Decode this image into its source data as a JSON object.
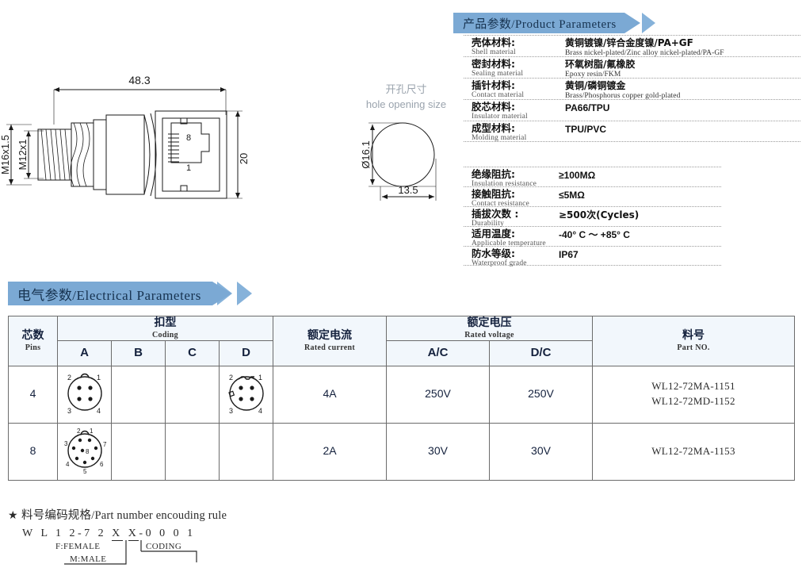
{
  "banners": {
    "product": {
      "zh": "产品参数",
      "sep": "/",
      "en": "Product Parameters"
    },
    "electrical": {
      "zh": "电气参数",
      "sep": "/",
      "en": "Electrical Parameters"
    }
  },
  "drawing": {
    "length_dim": "48.3",
    "height_dim": "20",
    "thread_outer": "M16x1.5",
    "thread_inner": "M12x1",
    "jack_pin_top": "8",
    "jack_pin_bottom": "1"
  },
  "hole_opening": {
    "title_zh": "开孔尺寸",
    "title_en": "hole opening size",
    "diameter": "Ø16.1",
    "width": "13.5"
  },
  "materials": [
    {
      "zh": "壳体材料:",
      "en": "Shell material",
      "value_zh": "黄铜镀镍/锌合金度镍/PA+GF",
      "value_en": "Brass nickel-plated/Zinc alloy nickel-plated/PA-GF"
    },
    {
      "zh": "密封材料:",
      "en": "Sealing material",
      "value_zh": "环氧树脂/氟橡胶",
      "value_en": "Epoxy resin/FKM"
    },
    {
      "zh": "插针材料:",
      "en": "Contact material",
      "value_zh": "黄铜/磷铜镀金",
      "value_en": "Brass/Phosphorus copper gold-plated"
    },
    {
      "zh": "胶芯材料:",
      "en": "Insulator material",
      "value_zh": "PA66/TPU",
      "value_en": ""
    },
    {
      "zh": "成型材料:",
      "en": "Molding material",
      "value_zh": "TPU/PVC",
      "value_en": ""
    }
  ],
  "electrical_spec": [
    {
      "zh": "绝缘阻抗:",
      "en": "Insulation resistance",
      "value": "≥100MΩ"
    },
    {
      "zh": "接触阻抗:",
      "en": "Contact resistance",
      "value": "≤5MΩ"
    },
    {
      "zh": "插拔次数 :",
      "en": "Durability",
      "value": "≥500次(Cycles)"
    },
    {
      "zh": "适用温度:",
      "en": "Applicable temperature",
      "value": "-40° C ～ +85° C"
    },
    {
      "zh": "防水等级:",
      "en": "Waterproof grade",
      "value": "IP67"
    }
  ],
  "electrical_table": {
    "headers": {
      "pins": {
        "zh": "芯数",
        "en": "Pins"
      },
      "coding": {
        "zh": "扣型",
        "en": "Coding"
      },
      "coding_cols": [
        "A",
        "B",
        "C",
        "D"
      ],
      "current": {
        "zh": "额定电流",
        "en": "Rated current"
      },
      "voltage": {
        "zh": "额定电压",
        "en": "Rated voltage"
      },
      "voltage_cols": [
        "A/C",
        "D/C"
      ],
      "partno": {
        "zh": "料号",
        "en": "Part NO."
      }
    },
    "rows": [
      {
        "pins": "4",
        "coding": {
          "A": "pinout-4-a",
          "B": "",
          "C": "",
          "D": "pinout-4-d"
        },
        "current": "4A",
        "voltage_ac": "250V",
        "voltage_dc": "250V",
        "part_numbers": [
          "WL12-72MA-1151",
          "WL12-72MD-1152"
        ]
      },
      {
        "pins": "8",
        "coding": {
          "A": "pinout-8-a",
          "B": "",
          "C": "",
          "D": ""
        },
        "current": "2A",
        "voltage_ac": "30V",
        "voltage_dc": "30V",
        "part_numbers": [
          "WL12-72MA-1153"
        ]
      }
    ]
  },
  "encoding_rule": {
    "star": "★",
    "title_zh": "料号编码规格",
    "title_sep": "/",
    "title_en": "Part number encouding rule",
    "code_prefix": "W L 1 2-7 2 ",
    "code_x1": "X",
    "code_x2": "X",
    "code_suffix": "-0 0 0 1",
    "female_label": "F:FEMALE",
    "male_label": "M:MALE",
    "coding_label": "CODING"
  },
  "colors": {
    "banner_fill": "#7ba9d4",
    "banner_chevron": "#86b2da",
    "banner_text": "#16324f",
    "table_header_bg": "#f2f7fc",
    "table_border": "#6b6b6b",
    "hole_title": "#9aa3ad"
  }
}
